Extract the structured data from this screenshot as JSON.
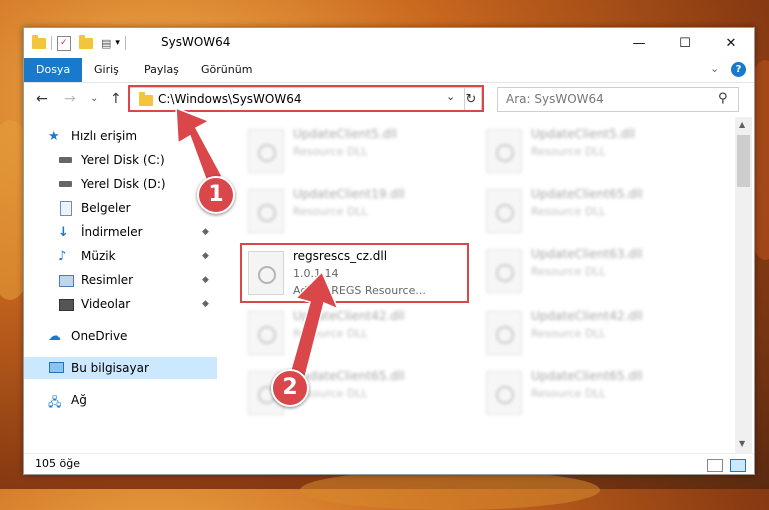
{
  "window": {
    "title": "SysWOW64",
    "minimize_glyph": "—",
    "maximize_glyph": "☐",
    "close_glyph": "✕"
  },
  "ribbon": {
    "tabs": [
      "Dosya",
      "Giriş",
      "Paylaş",
      "Görünüm"
    ],
    "help_glyph": "?",
    "collapse_glyph": "⌄"
  },
  "nav": {
    "back_glyph": "←",
    "forward_glyph": "→",
    "recent_glyph": "⌄",
    "up_glyph": "↑",
    "address": "C:\\Windows\\SysWOW64",
    "address_drop_glyph": "⌄",
    "refresh_glyph": "↻",
    "search_placeholder": "Ara: SysWOW64",
    "search_glyph": "⚲"
  },
  "sidebar": {
    "items": [
      {
        "label": "Hızlı erişim",
        "icon": "star-icon"
      },
      {
        "label": "Yerel Disk (C:)",
        "icon": "drive-icon"
      },
      {
        "label": "Yerel Disk (D:)",
        "icon": "drive-icon"
      },
      {
        "label": "Belgeler",
        "icon": "documents-icon"
      },
      {
        "label": "İndirmeler",
        "icon": "download-icon"
      },
      {
        "label": "Müzik",
        "icon": "music-icon"
      },
      {
        "label": "Resimler",
        "icon": "pictures-icon"
      },
      {
        "label": "Videolar",
        "icon": "video-icon"
      },
      {
        "label": "OneDrive",
        "icon": "cloud-icon"
      },
      {
        "label": "Bu bilgisayar",
        "icon": "computer-icon"
      },
      {
        "label": "Ağ",
        "icon": "network-icon"
      }
    ],
    "pin_glyph": "📌"
  },
  "files": [
    {
      "name": "UpdateClient5.dll",
      "desc": "Resource DLL"
    },
    {
      "name": "UpdateClient5.dll",
      "desc": "Resource DLL"
    },
    {
      "name": "UpdateClient19.dll",
      "desc": "Resource DLL"
    },
    {
      "name": "UpdateClient65.dll",
      "desc": "Resource DLL"
    },
    {
      "name": "regsrescs_cz.dll",
      "version": "1.0.1.14",
      "desc": "Adobe REGS Resource..."
    },
    {
      "name": "UpdateClient63.dll",
      "desc": "Resource DLL"
    },
    {
      "name": "UpdateClient42.dll",
      "desc": "Resource DLL"
    },
    {
      "name": "UpdateClient42.dll",
      "desc": "Resource DLL"
    },
    {
      "name": "UpdateClient65.dll",
      "desc": "Resource DLL"
    },
    {
      "name": "UpdateClient65.dll",
      "desc": "Resource DLL"
    }
  ],
  "status": {
    "count": "105 öğe"
  },
  "markers": [
    "1",
    "2"
  ],
  "colors": {
    "accent": "#1979ca",
    "highlight": "#d9474b",
    "selection": "#cce8ff"
  }
}
